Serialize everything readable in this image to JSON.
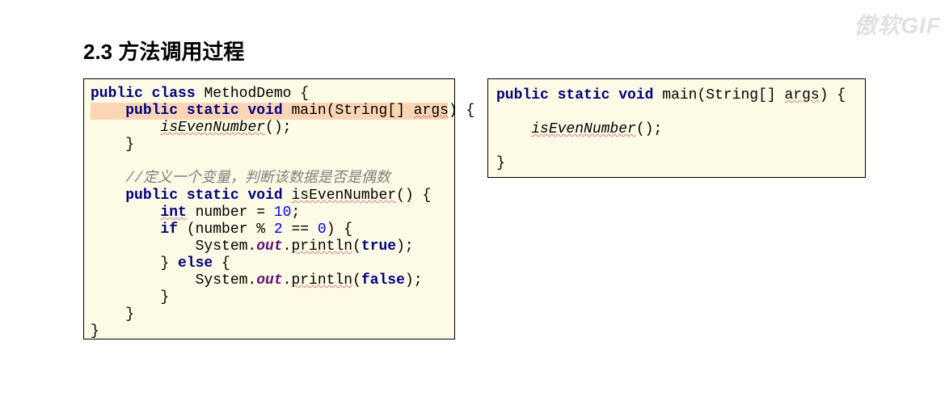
{
  "heading": "2.3 方法调用过程",
  "watermark": "傲软GIF",
  "left_code": {
    "l1_kw1": "public",
    "l1_kw2": "class",
    "l1_name": "MethodDemo",
    "l1_brace": " {",
    "l2_kw1": "public",
    "l2_kw2": "static",
    "l2_kw3": "void",
    "l2_name": " main(String[] ",
    "l2_arg": "args",
    "l2_end": ") {",
    "l3_call": "isEvenNumber",
    "l3_end": "();",
    "l4": "    }",
    "l5": "",
    "l6_cmt": "    //定义一个变量，判断该数据是否是偶数",
    "l7_kw1": "public",
    "l7_kw2": "static",
    "l7_kw3": "void",
    "l7_name": "isEvenNumber",
    "l7_end": "() {",
    "l8_kw": "int",
    "l8_rest": " number = ",
    "l8_num": "10",
    "l8_semi": ";",
    "l9_kw": "if",
    "l9_a": " (number % ",
    "l9_n2": "2",
    "l9_b": " == ",
    "l9_n0": "0",
    "l9_c": ") {",
    "l10_a": "            System.",
    "l10_out": "out",
    "l10_b": ".",
    "l10_pr": "println",
    "l10_c": "(",
    "l10_kw": "true",
    "l10_d": ");",
    "l11_a": "        } ",
    "l11_kw": "else",
    "l11_b": " {",
    "l12_a": "            System.",
    "l12_out": "out",
    "l12_b": ".",
    "l12_pr": "println",
    "l12_c": "(",
    "l12_kw": "false",
    "l12_d": ");",
    "l13": "        }",
    "l14": "    }",
    "l15": "}"
  },
  "right_code": {
    "l1_kw1": "public",
    "l1_kw2": "static",
    "l1_kw3": "void",
    "l1_name": " main(String[] ",
    "l1_arg": "args",
    "l1_end": ") {",
    "l2": "",
    "l3_call": "isEvenNumber",
    "l3_end": "();",
    "l4": "",
    "l5": "}"
  }
}
